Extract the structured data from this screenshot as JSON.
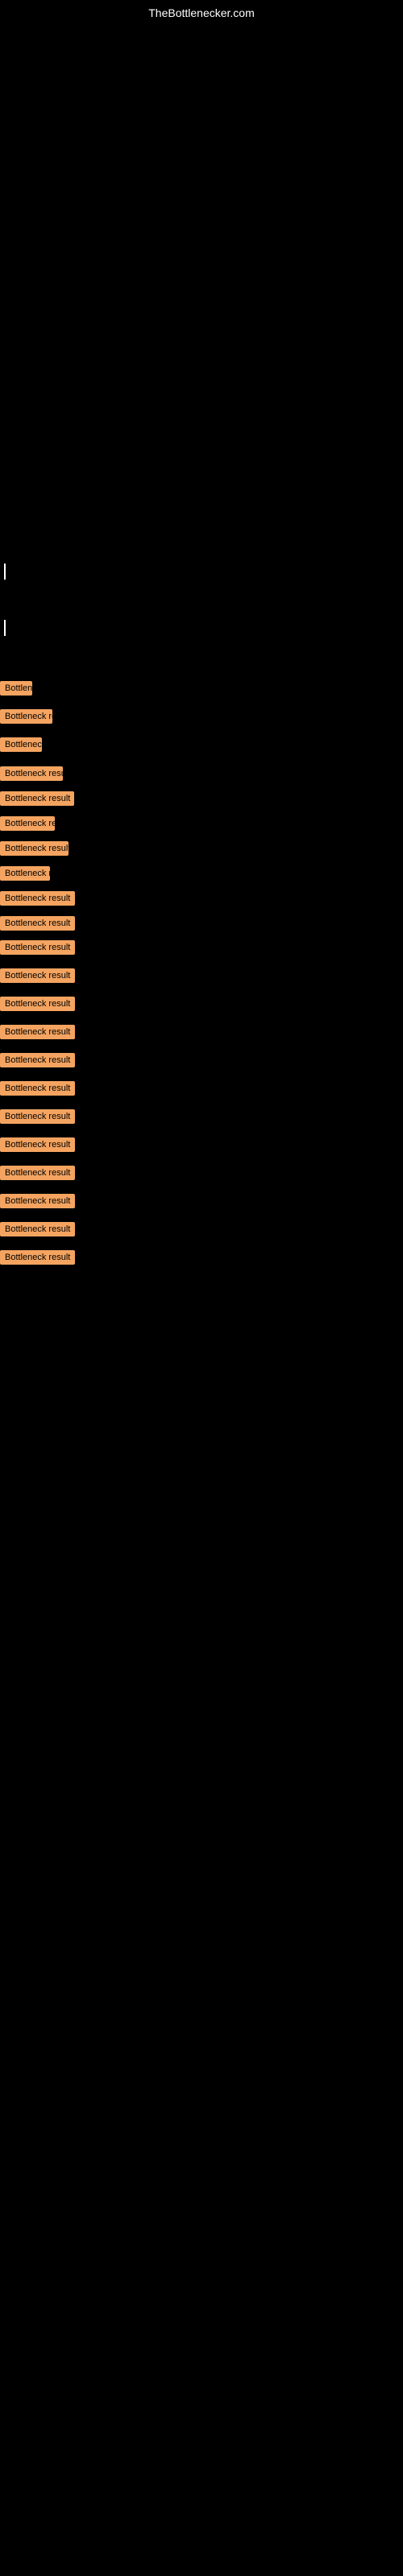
{
  "site": {
    "title": "TheBottlenecker.com"
  },
  "items": [
    {
      "label": "Bottleneck result",
      "size": "tiny",
      "id": "item-1"
    },
    {
      "label": "Bottleneck result",
      "size": "small",
      "id": "item-2"
    },
    {
      "label": "Bottleneck result",
      "size": "tiny2",
      "id": "item-3"
    },
    {
      "label": "Bottleneck result",
      "size": "medium1",
      "id": "item-4"
    },
    {
      "label": "Bottleneck result",
      "size": "medium2",
      "id": "item-5"
    },
    {
      "label": "Bottleneck result",
      "size": "small2",
      "id": "item-6"
    },
    {
      "label": "Bottleneck result",
      "size": "medium3",
      "id": "item-7"
    },
    {
      "label": "Bottleneck result",
      "size": "small3",
      "id": "item-8"
    },
    {
      "label": "Bottleneck result",
      "size": "medium4",
      "id": "item-9"
    },
    {
      "label": "Bottleneck result",
      "size": "medium5",
      "id": "item-10"
    },
    {
      "label": "Bottleneck result",
      "size": "large1",
      "id": "item-11"
    },
    {
      "label": "Bottleneck result",
      "size": "large2",
      "id": "item-12"
    },
    {
      "label": "Bottleneck result",
      "size": "large3",
      "id": "item-13"
    },
    {
      "label": "Bottleneck result",
      "size": "large4",
      "id": "item-14"
    },
    {
      "label": "Bottleneck result",
      "size": "large5",
      "id": "item-15"
    },
    {
      "label": "Bottleneck result",
      "size": "large6",
      "id": "item-16"
    },
    {
      "label": "Bottleneck result",
      "size": "large7",
      "id": "item-17"
    },
    {
      "label": "Bottleneck result",
      "size": "large8",
      "id": "item-18"
    },
    {
      "label": "Bottleneck result",
      "size": "large9",
      "id": "item-19"
    },
    {
      "label": "Bottleneck result",
      "size": "large10",
      "id": "item-20"
    },
    {
      "label": "Bottleneck result",
      "size": "large11",
      "id": "item-21"
    },
    {
      "label": "Bottleneck result",
      "size": "large12",
      "id": "item-22"
    }
  ]
}
